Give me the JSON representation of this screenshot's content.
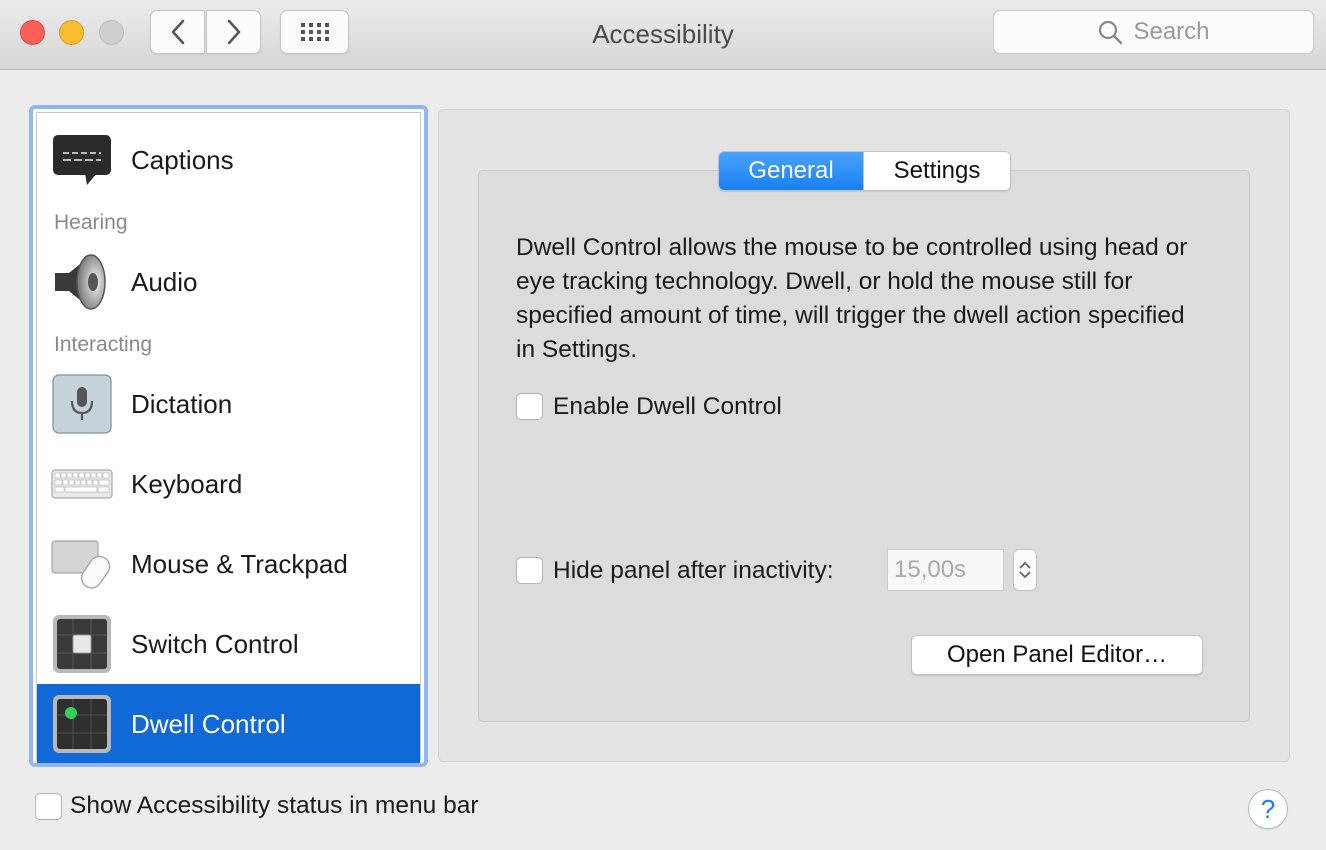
{
  "window": {
    "title": "Accessibility"
  },
  "toolbar": {
    "search_placeholder": "Search"
  },
  "sidebar": {
    "items": [
      {
        "label": "Captions",
        "icon": "captions-icon"
      },
      {
        "label": "Audio",
        "icon": "speaker-icon"
      },
      {
        "label": "Dictation",
        "icon": "microphone-icon"
      },
      {
        "label": "Keyboard",
        "icon": "keyboard-icon"
      },
      {
        "label": "Mouse & Trackpad",
        "icon": "mouse-trackpad-icon"
      },
      {
        "label": "Switch Control",
        "icon": "switch-control-icon"
      },
      {
        "label": "Dwell Control",
        "icon": "dwell-control-icon",
        "selected": true
      }
    ],
    "sections": {
      "hearing": "Hearing",
      "interacting": "Interacting"
    }
  },
  "main": {
    "tabs": [
      {
        "label": "General",
        "active": true
      },
      {
        "label": "Settings",
        "active": false
      }
    ],
    "description": "Dwell Control allows the mouse to be controlled using head or eye tracking technology. Dwell, or hold the mouse still for specified amount of time, will trigger the dwell action specified in Settings.",
    "enable_label": "Enable Dwell Control",
    "enable_checked": false,
    "hide_panel_label": "Hide panel after inactivity:",
    "hide_panel_checked": false,
    "hide_panel_value": "15,00s",
    "open_editor_label": "Open Panel Editor…"
  },
  "footer": {
    "status_label": "Show Accessibility status in menu bar",
    "status_checked": false,
    "help_label": "?"
  },
  "colors": {
    "selection": "#1069d6",
    "accent": "#1880f4",
    "focus_ring": "#8fb6ee"
  }
}
